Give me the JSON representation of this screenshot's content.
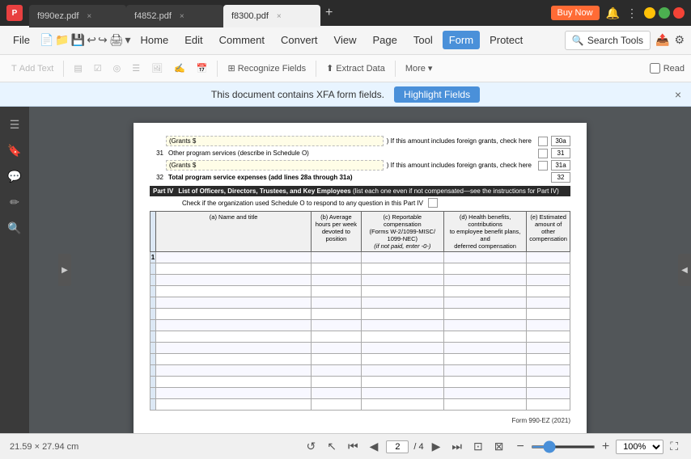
{
  "app": {
    "icon": "P",
    "tabs": [
      {
        "label": "f990ez.pdf",
        "active": false
      },
      {
        "label": "f4852.pdf",
        "active": false
      },
      {
        "label": "f8300.pdf",
        "active": true
      }
    ],
    "add_tab": "+",
    "buy_now": "Buy Now",
    "win_controls": [
      "min",
      "max",
      "close"
    ]
  },
  "menu": {
    "file": "File",
    "home": "Home",
    "edit": "Edit",
    "comment": "Comment",
    "convert": "Convert",
    "view": "View",
    "page": "Page",
    "tool": "Tool",
    "form": "Form",
    "protect": "Protect",
    "search_tools": "Search Tools"
  },
  "toolbar": {
    "add_text": "Add Text",
    "recognize_fields": "Recognize Fields",
    "extract_data": "Extract Data",
    "more": "More",
    "read": "Read"
  },
  "xfa_banner": {
    "message": "This document contains XFA form fields.",
    "highlight_btn": "Highlight Fields",
    "close": "×"
  },
  "side_icons": [
    "☰",
    "🔖",
    "💬",
    "✏",
    "🔍"
  ],
  "form": {
    "rows": [
      {
        "num": "",
        "label": "(Grants $",
        "input": "",
        "suffix": ") If this amount includes foreign grants, check here",
        "ref": "30a",
        "check": false
      },
      {
        "num": "31",
        "label": "Other program services (describe in Schedule O)",
        "input": "",
        "ref": "31",
        "check": false
      },
      {
        "num": "",
        "label": "(Grants $",
        "input": "",
        "suffix": ") If this amount includes foreign grants, check here",
        "ref": "31a",
        "check": false
      },
      {
        "num": "32",
        "label": "Total program service expenses (add lines 28a through 31a)",
        "input": "",
        "ref": "32",
        "check": false
      }
    ],
    "part4": {
      "label": "Part IV",
      "title": "List of Officers, Directors, Trustees, and Key Employees",
      "subtitle": "(list each one even if not compensated—see the instructions for Part IV)",
      "schedule_note": "Check if the organization used Schedule O to respond to any question in this Part IV",
      "table_headers": [
        "(a) Name and title",
        "(b) Average\nhours per week\ndevoted to position",
        "(c) Reportable compensation\n(Forms W-2/1099-MISC/\n1099-NEC)\n(if not paid, enter -0-)",
        "(d) Health benefits, contributions\nto employee benefit plans, and\ndeferred compensation",
        "(e) Estimated amount of other\ncompensation"
      ],
      "col_num_label": "1",
      "num_rows": 14
    },
    "footer": "Form 990-EZ (2021)"
  },
  "bottom_bar": {
    "page_size": "21.59 × 27.94 cm",
    "current_page": "2",
    "total_pages": "4",
    "zoom": "100%",
    "zoom_level": 100
  },
  "colors": {
    "active_tab_bg": "#f0f0f0",
    "inactive_tab_bg": "#3c3c3c",
    "menu_active": "#4a90d9",
    "highlight_btn": "#4a90d9",
    "buy_btn": "#ff6b35"
  }
}
